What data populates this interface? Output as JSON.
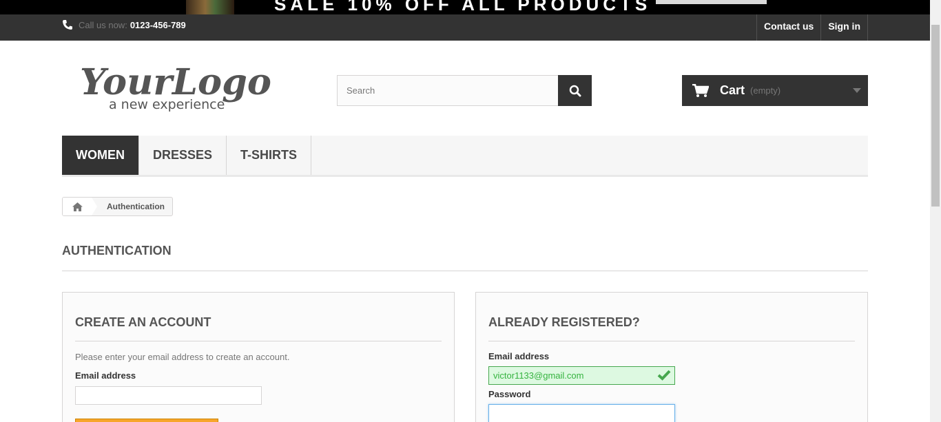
{
  "banner": {
    "text": "SALE 10% OFF ALL PRODUCTS"
  },
  "topbar": {
    "call_label": "Call us now:",
    "phone": "0123-456-789",
    "contact_label": "Contact us",
    "signin_label": "Sign in"
  },
  "logo": {
    "text": "YourLogo",
    "tagline": "a new experience"
  },
  "search": {
    "placeholder": "Search",
    "value": ""
  },
  "cart": {
    "label": "Cart",
    "status": "(empty)"
  },
  "menu": {
    "items": [
      {
        "label": "Women"
      },
      {
        "label": "Dresses"
      },
      {
        "label": "T-shirts"
      }
    ],
    "active": "Women"
  },
  "breadcrumb": {
    "current": "Authentication"
  },
  "page": {
    "heading": "Authentication"
  },
  "create_account": {
    "title": "Create an account",
    "instructions": "Please enter your email address to create an account.",
    "email_label": "Email address",
    "email_value": ""
  },
  "login": {
    "title": "Already registered?",
    "email_label": "Email address",
    "email_value": "victor1133@gmail.com",
    "password_label": "Password",
    "password_value": ""
  },
  "colors": {
    "dark": "#333333",
    "accent": "#f7a52b",
    "valid_bg": "#ddf9e1",
    "valid_text": "#35b33f"
  }
}
